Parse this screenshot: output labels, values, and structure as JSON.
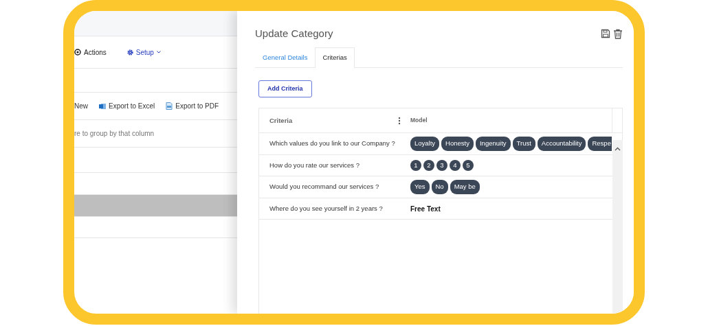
{
  "background_app": {
    "toolbar": [
      {
        "kind": "actions",
        "label": "Actions"
      },
      {
        "kind": "setup",
        "label": "Setup"
      }
    ],
    "grid_toolbar": [
      {
        "kind": "new",
        "label": "New"
      },
      {
        "kind": "excel",
        "label": "Export to Excel"
      },
      {
        "kind": "pdf",
        "label": "Export to PDF"
      }
    ],
    "group_hint": "re to group by that column"
  },
  "panel": {
    "title": "Update Category",
    "tabs": [
      {
        "label": "General Details",
        "selected": false
      },
      {
        "label": "Criterias",
        "selected": true
      }
    ],
    "add_button": "Add Criteria",
    "table": {
      "columns": [
        "Criteria",
        "Model"
      ],
      "rows": [
        {
          "criteria": "Which values do you link to our Company ?",
          "model": {
            "kind": "chips",
            "items": [
              "Loyalty",
              "Honesty",
              "Ingenuity",
              "Trust",
              "Accountability",
              "Respe"
            ]
          }
        },
        {
          "criteria": "How do you rate our services ?",
          "model": {
            "kind": "circles",
            "items": [
              "1",
              "2",
              "3",
              "4",
              "5"
            ]
          }
        },
        {
          "criteria": "Would you recommand our services ?",
          "model": {
            "kind": "chips",
            "items": [
              "Yes",
              "No",
              "May be"
            ]
          }
        },
        {
          "criteria": "Where do you see yourself in 2 years ?",
          "model": {
            "kind": "text",
            "text": "Free Text"
          }
        }
      ]
    }
  }
}
